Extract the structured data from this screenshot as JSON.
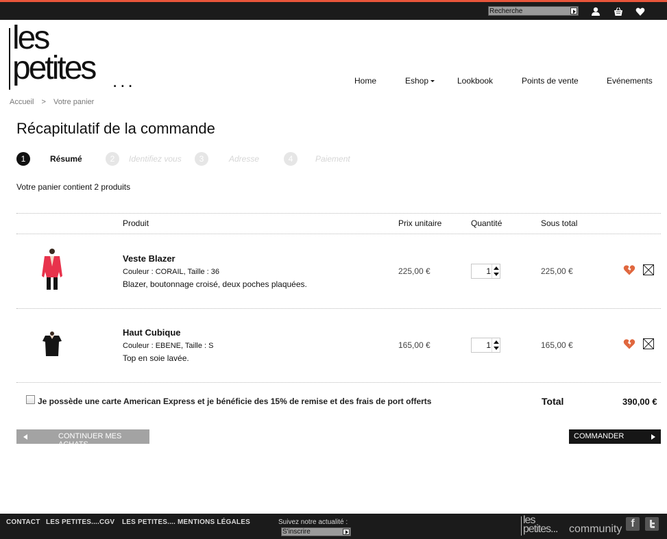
{
  "topbar": {
    "search_placeholder": "Recherche"
  },
  "logo": {
    "line1": "les",
    "line2": "petites",
    "dots": "..."
  },
  "nav": {
    "home": "Home",
    "eshop": "Eshop",
    "lookbook": "Lookbook",
    "points_de_vente": "Points de vente",
    "evenements": "Evénements"
  },
  "breadcrumb": {
    "home": "Accueil",
    "separator": ">",
    "current": "Votre panier"
  },
  "page_title": "Récapitulatif de la commande",
  "steps": [
    {
      "num": "1",
      "label": "Résumé",
      "active": true
    },
    {
      "num": "2",
      "label": "Identifiez vous",
      "active": false
    },
    {
      "num": "3",
      "label": "Adresse",
      "active": false
    },
    {
      "num": "4",
      "label": "Paiement",
      "active": false
    }
  ],
  "cart_count_text": "Votre panier contient 2 produits",
  "table_headers": {
    "product": "Produit",
    "unit_price": "Prix unitaire",
    "quantity": "Quantité",
    "subtotal": "Sous total"
  },
  "items": [
    {
      "name": "Veste Blazer",
      "attributes": "Couleur : CORAIL, Taille : 36",
      "description": "Blazer, boutonnage croisé, deux poches plaquées.",
      "unit_price": "225,00 €",
      "quantity": "1",
      "subtotal": "225,00 €"
    },
    {
      "name": "Haut Cubique",
      "attributes": "Couleur : EBENE, Taille : S",
      "description": "Top en soie lavée.",
      "unit_price": "165,00 €",
      "quantity": "1",
      "subtotal": "165,00 €"
    }
  ],
  "amex_text": "Je possède une carte American Express et je bénéficie des 15% de remise et des frais de port offerts",
  "total": {
    "label": "Total",
    "value": "390,00 €"
  },
  "buttons": {
    "continue": "CONTINUER MES ACHATS",
    "order": "COMMANDER"
  },
  "footer": {
    "contact": "CONTACT",
    "cgv": "LES PETITES....CGV",
    "mentions": "LES PETITES.... MENTIONS LÉGALES",
    "follow": "Suivez notre actualité :",
    "newsletter_placeholder": "S'inscrire",
    "logo_line1": "les",
    "logo_line2": "petites...",
    "logo_line3": "community",
    "facebook": "f"
  },
  "colors": {
    "accent": "#e8553a",
    "bar": "#1b1b1b",
    "heart": "#e0673e",
    "jacket": "#e8334c"
  }
}
